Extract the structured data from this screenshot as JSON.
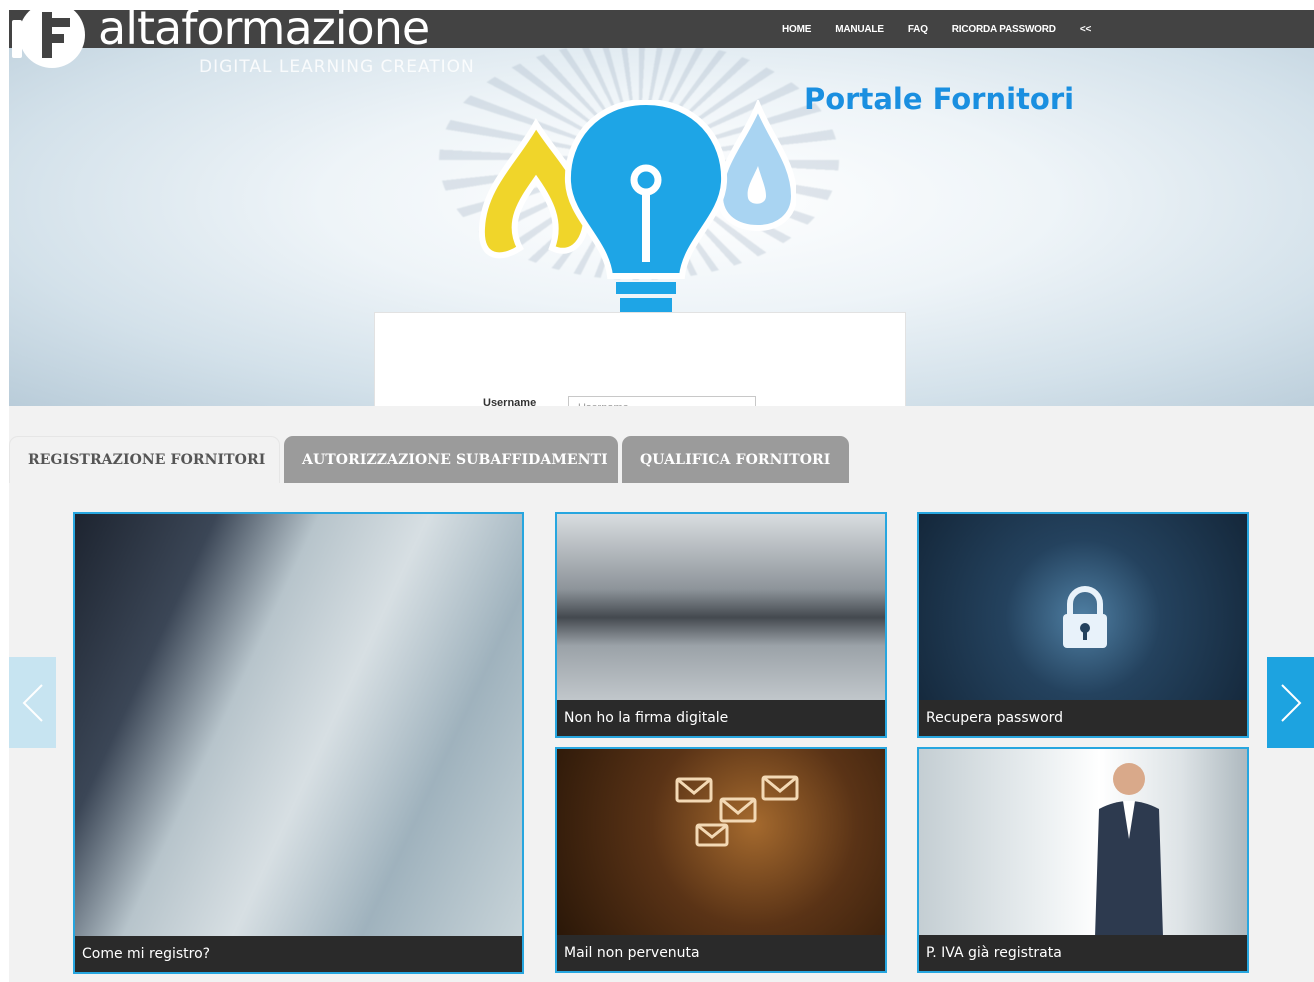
{
  "brand": {
    "logo_text": "altaformazione",
    "tagline": "DIGITAL LEARNING CREATION"
  },
  "nav": {
    "items": [
      {
        "label": "HOME"
      },
      {
        "label": "MANUALE"
      },
      {
        "label": "FAQ"
      },
      {
        "label": "RICORDA PASSWORD"
      },
      {
        "label": "<<"
      }
    ]
  },
  "hero": {
    "title": "Portale Fornitori",
    "icons": [
      "flame-icon",
      "lightbulb-icon",
      "water-drop-icon"
    ]
  },
  "login": {
    "username_label": "Username",
    "username_placeholder": "Username",
    "username_value": ""
  },
  "tabs": [
    {
      "label": "REGISTRAZIONE FORNITORI",
      "active": true
    },
    {
      "label": "AUTORIZZAZIONE SUBAFFIDAMENTI",
      "active": false
    },
    {
      "label": "QUALIFICA FORNITORI",
      "active": false
    }
  ],
  "cards": {
    "registro": {
      "caption": "Come mi registro?"
    },
    "firma": {
      "caption": "Non ho la firma digitale"
    },
    "password": {
      "caption": "Recupera password"
    },
    "mail": {
      "caption": "Mail non pervenuta"
    },
    "piva": {
      "caption": "P. IVA già registrata"
    }
  },
  "carousel": {
    "prev_icon": "chevron-left-icon",
    "next_icon": "chevron-right-icon"
  },
  "colors": {
    "topbar": "#434343",
    "title_blue": "#1a8fe0",
    "accent_blue": "#27a6df",
    "tab_inactive": "#9b9b9b",
    "caption_bg": "#2a2a2a"
  }
}
